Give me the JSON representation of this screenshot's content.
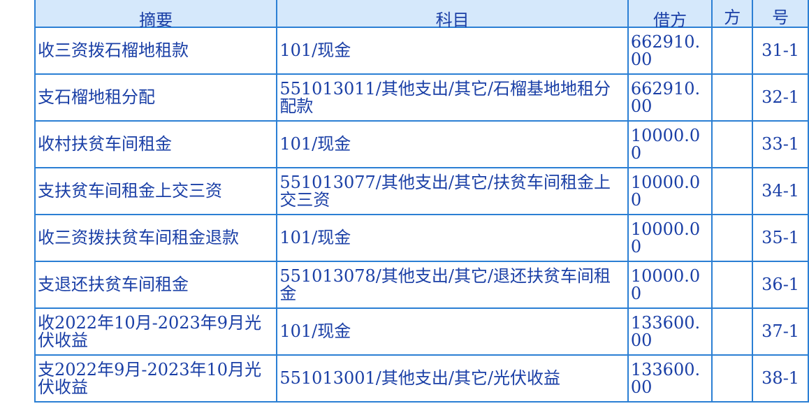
{
  "table": {
    "headers": {
      "summary": "摘要",
      "account": "科目",
      "amount": "借方",
      "direction": "方",
      "number": "号"
    },
    "rows": [
      {
        "summary": "收三资拨石榴地租款",
        "account": "101/现金",
        "amount": "662910.00",
        "direction": "",
        "number": "31-1"
      },
      {
        "summary": "支石榴地租分配",
        "account": "551013011/其他支出/其它/石榴基地地租分配款",
        "amount": "662910.00",
        "direction": "",
        "number": "32-1"
      },
      {
        "summary": "收村扶贫车间租金",
        "account": "101/现金",
        "amount": "10000.00",
        "direction": "",
        "number": "33-1"
      },
      {
        "summary": "支扶贫车间租金上交三资",
        "account": "551013077/其他支出/其它/扶贫车间租金上交三资",
        "amount": "10000.00",
        "direction": "",
        "number": "34-1"
      },
      {
        "summary": "收三资拨扶贫车间租金退款",
        "account": "101/现金",
        "amount": "10000.00",
        "direction": "",
        "number": "35-1"
      },
      {
        "summary": "支退还扶贫车间租金",
        "account": "551013078/其他支出/其它/退还扶贫车间租金",
        "amount": "10000.00",
        "direction": "",
        "number": "36-1"
      },
      {
        "summary": "收2022年10月-2023年9月光伏收益",
        "account": "101/现金",
        "amount": "133600.00",
        "direction": "",
        "number": "37-1"
      },
      {
        "summary": "支2022年9月-2023年10月光伏收益",
        "account": "551013001/其他支出/其它/光伏收益",
        "amount": "133600.00",
        "direction": "",
        "number": "38-1"
      }
    ]
  }
}
